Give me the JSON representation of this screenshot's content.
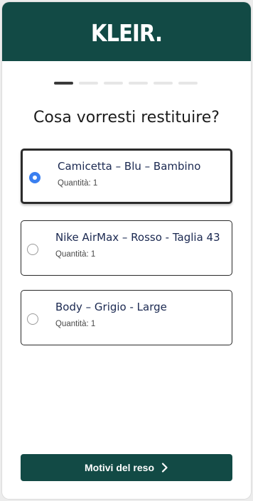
{
  "brand": {
    "logo_text": "KLEIR."
  },
  "stepper": {
    "total_steps": 6,
    "current_step": 1
  },
  "question": "Cosa vorresti restituire?",
  "options": [
    {
      "title": "Camicetta – Blu – Bambino",
      "quantity": "Quantità: 1",
      "selected": true
    },
    {
      "title": "Nike AirMax – Rosso - Taglia 43",
      "quantity": "Quantità: 1",
      "selected": false
    },
    {
      "title": "Body – Grigio - Large",
      "quantity": "Quantità: 1",
      "selected": false
    }
  ],
  "cta": {
    "label": "Motivi del reso",
    "icon": "chevron-right-icon"
  },
  "colors": {
    "brand": "#124a45",
    "radio_selected": "#3a7ff0",
    "text_title": "#1a2850"
  }
}
